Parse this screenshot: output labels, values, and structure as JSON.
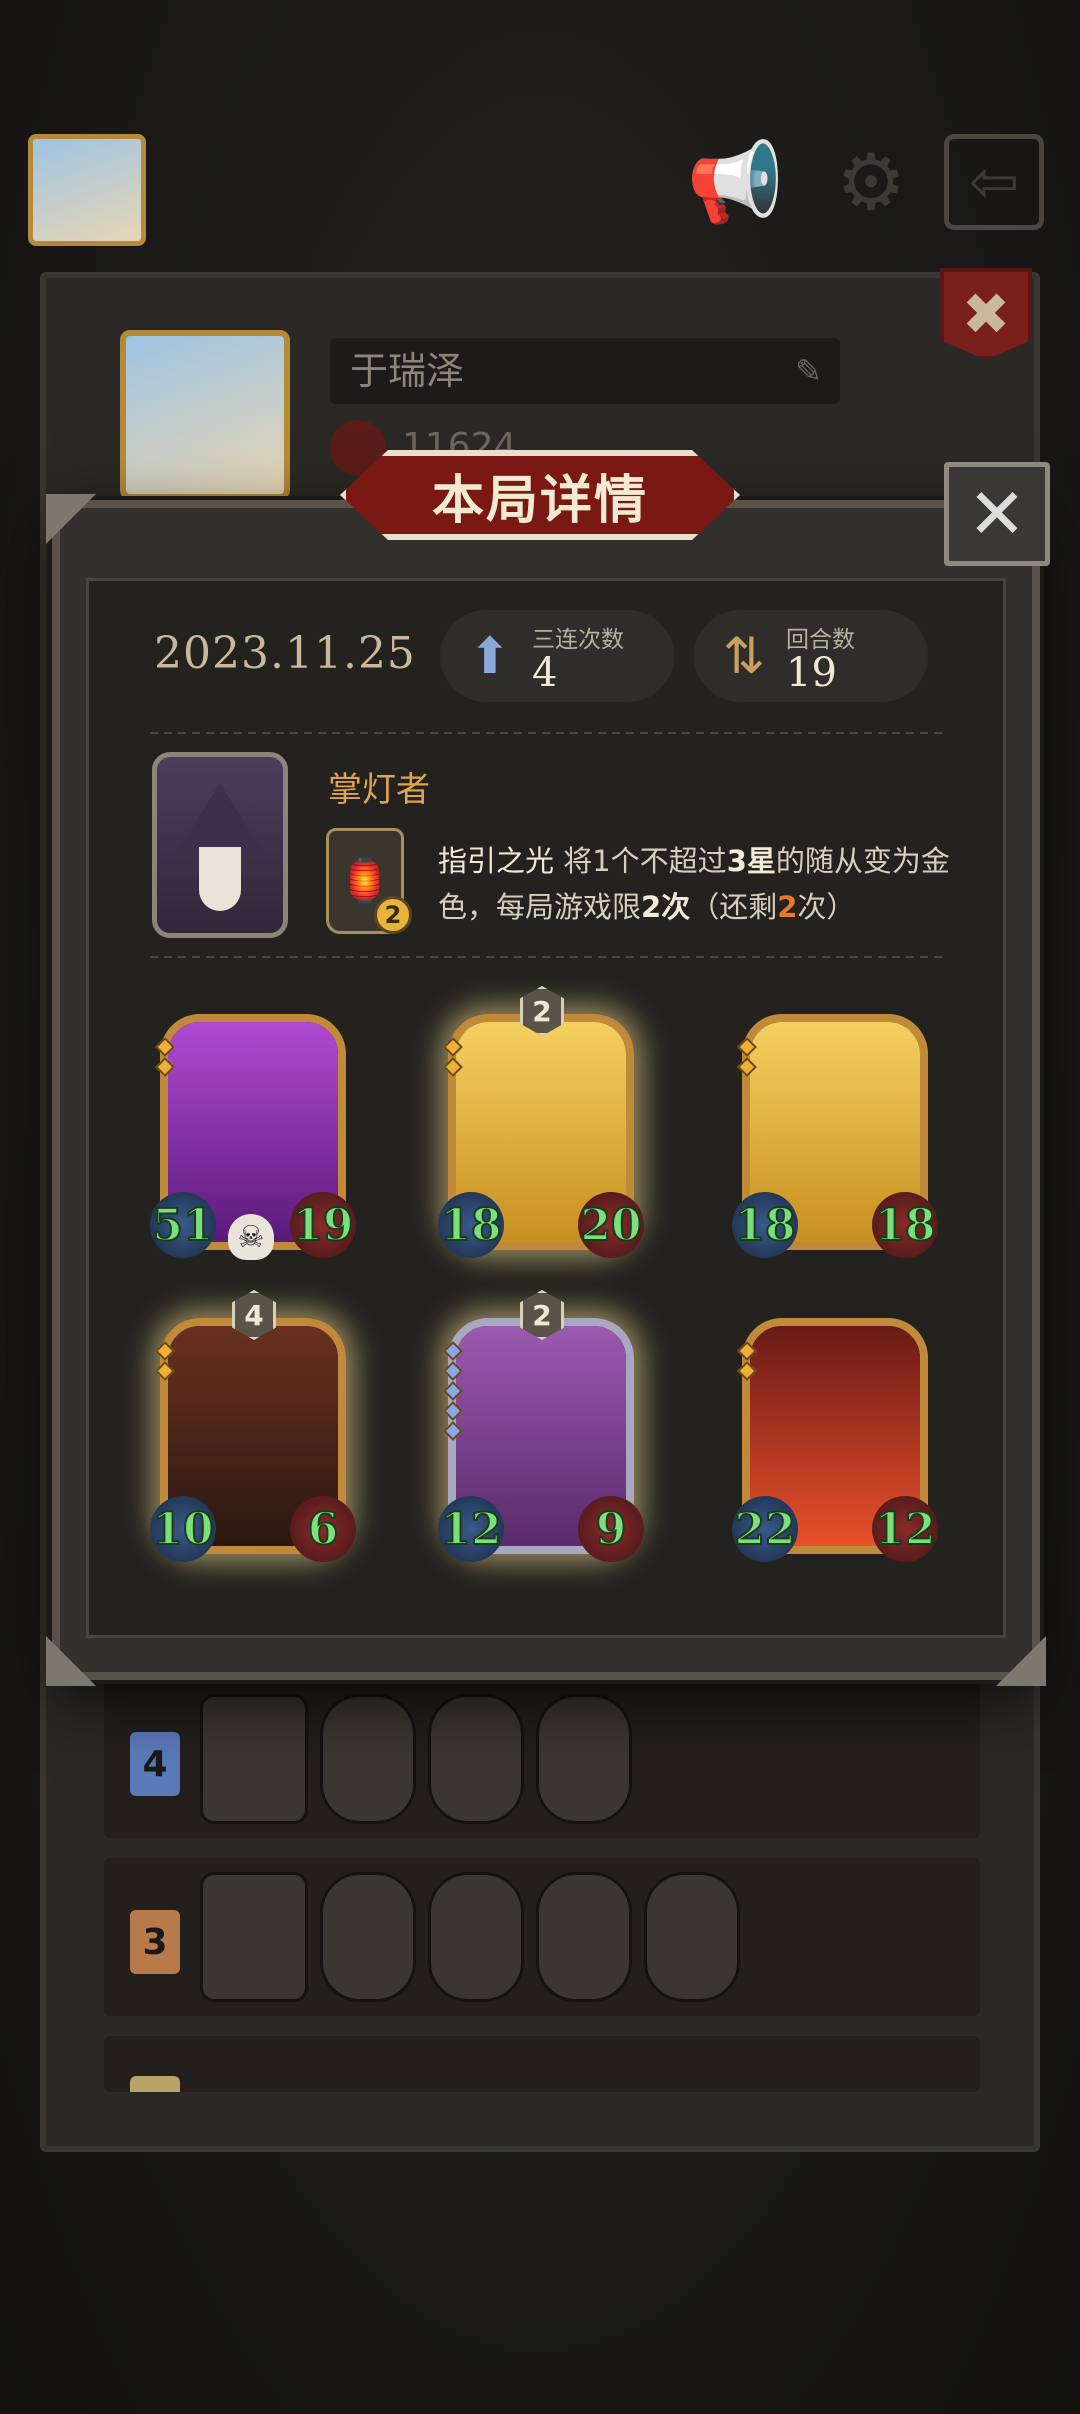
{
  "topbar": {
    "sound_icon": "megaphone-icon",
    "settings_icon": "gear-icon",
    "exit_icon": "exit-icon"
  },
  "profile": {
    "name": "于瑞泽",
    "score": "11624"
  },
  "modal": {
    "title": "本局详情",
    "close_icon": "close-icon"
  },
  "summary": {
    "date": "2023.11.25",
    "triples_label": "三连次数",
    "triples_value": "4",
    "rounds_label": "回合数",
    "rounds_value": "19"
  },
  "hero": {
    "name": "掌灯者",
    "skill_name": "指引之光",
    "skill_desc_1": " 将1个不超过",
    "skill_desc_hi": "3星",
    "skill_desc_2": "的随从变为金色，每局游戏限",
    "skill_desc_hi2": "2次",
    "skill_desc_3": "（还剩",
    "skill_desc_remain": "2",
    "skill_desc_4": "次）",
    "skill_uses": "2"
  },
  "units": [
    {
      "atk": "51",
      "hp": "19",
      "tier": "",
      "color_top": "#b04ad0",
      "color_bottom": "#5a1a7a"
    },
    {
      "atk": "18",
      "hp": "20",
      "tier": "2",
      "color_top": "#f4d060",
      "color_bottom": "#c89020"
    },
    {
      "atk": "18",
      "hp": "18",
      "tier": "",
      "color_top": "#f4d060",
      "color_bottom": "#c89020"
    },
    {
      "atk": "10",
      "hp": "6",
      "tier": "4",
      "color_top": "#6a3020",
      "color_bottom": "#2a1810"
    },
    {
      "atk": "12",
      "hp": "9",
      "tier": "2",
      "color_top": "#9a5ab0",
      "color_bottom": "#5a2a6a"
    },
    {
      "atk": "22",
      "hp": "12",
      "tier": "",
      "color_top": "#6a1a18",
      "color_bottom": "#e8502a"
    }
  ],
  "history_rows": [
    {
      "rank": "4",
      "color": "#5a7ab8"
    },
    {
      "rank": "3",
      "color": "#b87a4a"
    },
    {
      "rank": "",
      "color": "#c9b070"
    }
  ]
}
